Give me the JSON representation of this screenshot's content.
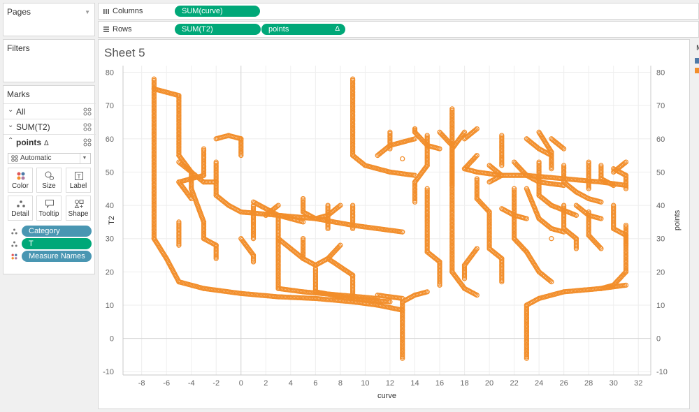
{
  "cards": {
    "pages_title": "Pages",
    "filters_title": "Filters",
    "marks_title": "Marks"
  },
  "marks": {
    "rows": [
      {
        "label": "All",
        "expanded": false
      },
      {
        "label": "SUM(T2)",
        "expanded": false
      },
      {
        "label": "points",
        "expanded": true,
        "suffix": "Δ"
      }
    ],
    "mark_type": "Automatic",
    "buttons": [
      {
        "label": "Color",
        "icon": "color-dots-icon"
      },
      {
        "label": "Size",
        "icon": "size-icon"
      },
      {
        "label": "Label",
        "icon": "label-icon"
      },
      {
        "label": "Detail",
        "icon": "detail-dots-icon"
      },
      {
        "label": "Tooltip",
        "icon": "tooltip-icon"
      },
      {
        "label": "Shape",
        "icon": "shape-icon"
      }
    ],
    "fields": [
      {
        "label": "Category",
        "icon": "detail-dots-icon",
        "color": "#4996b2"
      },
      {
        "label": "T",
        "icon": "detail-dots-icon",
        "color": "#00a878"
      },
      {
        "label": "Measure Names",
        "icon": "color-dots-icon",
        "color": "#4996b2"
      }
    ]
  },
  "shelves": {
    "columns_label": "Columns",
    "rows_label": "Rows",
    "columns_pills": [
      "SUM(curve)"
    ],
    "rows_pills": [
      "SUM(T2)",
      "points"
    ],
    "rows_pill_suffix": "Δ"
  },
  "sheet": {
    "title": "Sheet 5"
  },
  "legend": {
    "title_fragment": "M",
    "swatches": [
      "#4e79a7",
      "#f28e2b"
    ]
  },
  "colors": {
    "orange": "#f28e2b",
    "pill_green": "#00a878",
    "pill_blue": "#4996b2"
  },
  "chart_data": {
    "type": "scatter",
    "xlabel": "curve",
    "ylabel": "T2",
    "y2label": "points",
    "xlim": [
      -9.5,
      33
    ],
    "ylim": [
      -11,
      82
    ],
    "x_ticks": [
      -8,
      -6,
      -4,
      -2,
      0,
      2,
      4,
      6,
      8,
      10,
      12,
      14,
      16,
      18,
      20,
      22,
      24,
      26,
      28,
      30,
      32
    ],
    "y_ticks": [
      -10,
      0,
      10,
      20,
      30,
      40,
      50,
      60,
      70,
      80
    ],
    "y2_ticks": [
      -10,
      0,
      10,
      20,
      30,
      40,
      50,
      60,
      70,
      80
    ],
    "series": [
      {
        "mark": "open-circle",
        "color": "#f28e2b",
        "polylines": [
          [
            [
              -7,
              78
            ],
            [
              -7,
              30
            ],
            [
              -6,
              24
            ],
            [
              -5,
              17
            ],
            [
              -3,
              15
            ],
            [
              0,
              13.5
            ],
            [
              3,
              12.5
            ],
            [
              6,
              12
            ],
            [
              9,
              11
            ],
            [
              11,
              10
            ],
            [
              13,
              8.5
            ]
          ],
          [
            [
              -7,
              75
            ],
            [
              -5,
              73
            ],
            [
              -5,
              55
            ],
            [
              -4,
              50
            ],
            [
              -4,
              45
            ],
            [
              -3,
              35
            ],
            [
              -3,
              30
            ],
            [
              -2,
              28
            ],
            [
              -2,
              24
            ]
          ],
          [
            [
              -5,
              53
            ],
            [
              -3,
              47
            ],
            [
              -2,
              47
            ]
          ],
          [
            [
              -3,
              57
            ],
            [
              -3,
              49
            ],
            [
              -5,
              47
            ],
            [
              -4,
              42
            ]
          ],
          [
            [
              -2,
              53
            ],
            [
              -2,
              43
            ],
            [
              -1,
              40
            ],
            [
              0,
              38
            ],
            [
              3,
              37
            ],
            [
              6,
              36
            ],
            [
              9,
              34
            ],
            [
              13,
              32
            ]
          ],
          [
            [
              -2,
              60
            ],
            [
              -1,
              61
            ],
            [
              0,
              60
            ],
            [
              0,
              55
            ]
          ],
          [
            [
              -5,
              35
            ],
            [
              -5,
              28
            ]
          ],
          [
            [
              0,
              30
            ],
            [
              1,
              25
            ],
            [
              1,
              23
            ]
          ],
          [
            [
              1,
              40
            ],
            [
              1,
              35
            ],
            [
              1,
              30
            ]
          ],
          [
            [
              1,
              41
            ],
            [
              3,
              37
            ],
            [
              4,
              36
            ],
            [
              5,
              35
            ]
          ],
          [
            [
              3,
              40
            ],
            [
              2,
              37
            ]
          ],
          [
            [
              3,
              37
            ],
            [
              3,
              30
            ],
            [
              4,
              27
            ],
            [
              5,
              24
            ]
          ],
          [
            [
              5,
              42
            ],
            [
              5,
              38
            ],
            [
              6,
              36
            ]
          ],
          [
            [
              6,
              36
            ],
            [
              7,
              37
            ],
            [
              8,
              40
            ]
          ],
          [
            [
              7,
              40
            ],
            [
              7,
              33
            ]
          ],
          [
            [
              3,
              30
            ],
            [
              3,
              15
            ],
            [
              5,
              14
            ],
            [
              8,
              13
            ],
            [
              11,
              12
            ]
          ],
          [
            [
              5,
              30
            ],
            [
              5,
              24
            ],
            [
              6,
              22
            ],
            [
              7,
              24
            ],
            [
              8,
              28
            ]
          ],
          [
            [
              6,
              21
            ],
            [
              6,
              14
            ],
            [
              9,
              12
            ],
            [
              12,
              11
            ]
          ],
          [
            [
              7,
              24
            ],
            [
              9,
              19
            ],
            [
              9,
              12
            ]
          ],
          [
            [
              9,
              78
            ],
            [
              9,
              55
            ],
            [
              10,
              52
            ],
            [
              12,
              50
            ],
            [
              14,
              49
            ]
          ],
          [
            [
              9,
              40
            ],
            [
              9,
              33
            ]
          ],
          [
            [
              11,
              55
            ],
            [
              12,
              58
            ],
            [
              14,
              60
            ]
          ],
          [
            [
              12,
              62
            ],
            [
              12,
              57
            ]
          ],
          [
            [
              13,
              54
            ]
          ],
          [
            [
              13,
              -6
            ],
            [
              13,
              11
            ],
            [
              14,
              13
            ],
            [
              15,
              14
            ]
          ],
          [
            [
              13,
              12
            ],
            [
              11,
              13
            ]
          ],
          [
            [
              14,
              63
            ],
            [
              14,
              62
            ],
            [
              15,
              58
            ],
            [
              16,
              57
            ]
          ],
          [
            [
              15,
              61
            ],
            [
              15,
              52
            ],
            [
              14,
              47
            ],
            [
              14,
              41
            ]
          ],
          [
            [
              15,
              45
            ],
            [
              15,
              26
            ],
            [
              16,
              23
            ],
            [
              16,
              16
            ]
          ],
          [
            [
              16,
              62
            ],
            [
              17,
              58
            ],
            [
              17,
              46
            ]
          ],
          [
            [
              17,
              69
            ],
            [
              17,
              20
            ],
            [
              18,
              15
            ],
            [
              19,
              13
            ]
          ],
          [
            [
              18,
              62
            ],
            [
              17,
              57
            ]
          ],
          [
            [
              19,
              63
            ],
            [
              18,
              60
            ]
          ],
          [
            [
              19,
              55
            ],
            [
              18,
              51
            ],
            [
              19,
              50
            ],
            [
              21,
              49
            ],
            [
              23,
              49
            ],
            [
              26,
              48
            ],
            [
              29,
              47
            ],
            [
              31,
              46
            ]
          ],
          [
            [
              20,
              52
            ],
            [
              21,
              49
            ],
            [
              20,
              47
            ]
          ],
          [
            [
              21,
              61
            ],
            [
              21,
              52
            ]
          ],
          [
            [
              19,
              27
            ],
            [
              18,
              22
            ],
            [
              18,
              18
            ]
          ],
          [
            [
              20,
              38
            ],
            [
              20,
              27
            ],
            [
              21,
              24
            ],
            [
              21,
              17
            ]
          ],
          [
            [
              19,
              48
            ],
            [
              19,
              42
            ],
            [
              20,
              38
            ]
          ],
          [
            [
              21,
              39
            ],
            [
              22,
              37
            ],
            [
              23,
              36
            ]
          ],
          [
            [
              22,
              45
            ],
            [
              22,
              30
            ],
            [
              23,
              26
            ],
            [
              24,
              20
            ],
            [
              25,
              17
            ]
          ],
          [
            [
              22,
              53
            ],
            [
              23,
              49
            ],
            [
              24,
              47
            ],
            [
              26,
              46
            ]
          ],
          [
            [
              23,
              60
            ],
            [
              24,
              57
            ],
            [
              25,
              55
            ]
          ],
          [
            [
              24,
              62
            ],
            [
              25,
              56
            ],
            [
              25,
              51
            ]
          ],
          [
            [
              25,
              60
            ],
            [
              26,
              57
            ]
          ],
          [
            [
              23,
              -6
            ],
            [
              23,
              10
            ],
            [
              24,
              12
            ],
            [
              26,
              14
            ],
            [
              29,
              15
            ],
            [
              31,
              16
            ]
          ],
          [
            [
              23,
              45
            ],
            [
              24,
              36
            ],
            [
              25,
              33
            ],
            [
              26,
              32
            ]
          ],
          [
            [
              24,
              53
            ],
            [
              24,
              43
            ],
            [
              25,
              40
            ],
            [
              27,
              37
            ]
          ],
          [
            [
              25,
              30
            ]
          ],
          [
            [
              26,
              52
            ],
            [
              26,
              47
            ],
            [
              27,
              44
            ]
          ],
          [
            [
              27,
              40
            ],
            [
              28,
              37
            ],
            [
              29,
              36
            ]
          ],
          [
            [
              28,
              53
            ],
            [
              28,
              45
            ]
          ],
          [
            [
              29,
              52
            ],
            [
              29,
              48
            ],
            [
              30,
              46
            ]
          ],
          [
            [
              30,
              51
            ],
            [
              31,
              49
            ],
            [
              31,
              45
            ]
          ],
          [
            [
              31,
              53
            ],
            [
              30,
              50
            ]
          ],
          [
            [
              26,
              40
            ],
            [
              26,
              33
            ],
            [
              27,
              30
            ],
            [
              27,
              27
            ]
          ],
          [
            [
              28,
              38
            ],
            [
              28,
              31
            ],
            [
              29,
              27
            ]
          ],
          [
            [
              30,
              40
            ],
            [
              30,
              33
            ],
            [
              31,
              31
            ],
            [
              31,
              28
            ]
          ],
          [
            [
              31,
              34
            ],
            [
              31,
              20
            ],
            [
              30,
              16
            ],
            [
              29,
              15
            ]
          ],
          [
            [
              27,
              44
            ],
            [
              28,
              42
            ],
            [
              29,
              41
            ]
          ]
        ]
      }
    ]
  }
}
